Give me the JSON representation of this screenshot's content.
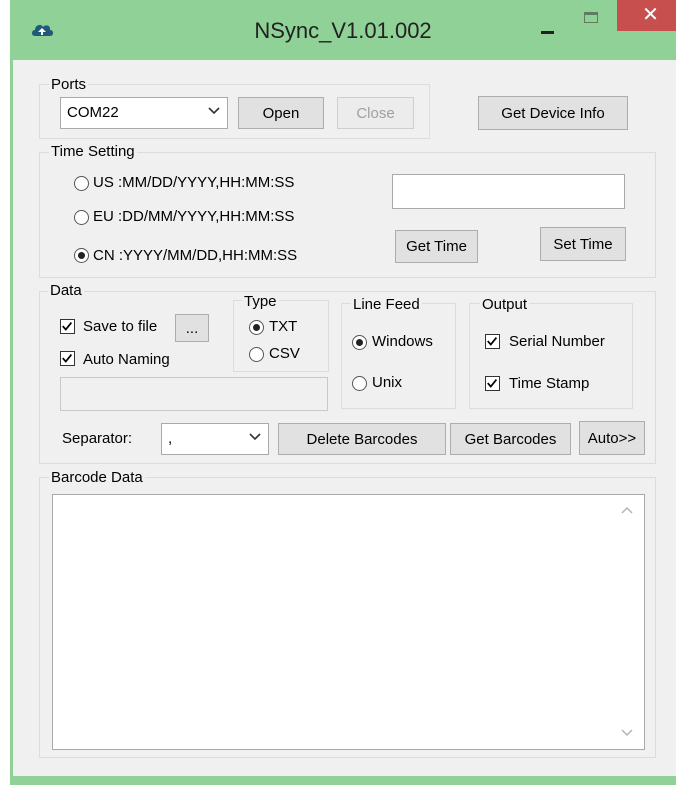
{
  "window": {
    "title": "NSync_V1.01.002",
    "close_glyph": "✕",
    "icon": "cloud-upload-icon",
    "accent": "#8fd197",
    "close_color": "#c7504e"
  },
  "ports": {
    "legend": "Ports",
    "com_value": "COM22",
    "open_label": "Open",
    "close_label": "Close",
    "device_info_label": "Get Device Info"
  },
  "time": {
    "legend": "Time Setting",
    "us_label": "US :MM/DD/YYYY,HH:MM:SS",
    "eu_label": "EU :DD/MM/YYYY,HH:MM:SS",
    "cn_label": "CN :YYYY/MM/DD,HH:MM:SS",
    "selected": "CN",
    "time_value": "",
    "get_label": "Get Time",
    "set_label": "Set Time"
  },
  "data": {
    "legend": "Data",
    "save_label": "Save to file",
    "save_checked": true,
    "browse_label": "...",
    "auto_naming_label": "Auto Naming",
    "auto_naming_checked": true,
    "path_value": "",
    "type_legend": "Type",
    "txt_label": "TXT",
    "csv_label": "CSV",
    "type_selected": "TXT",
    "linefeed_legend": "Line Feed",
    "windows_label": "Windows",
    "unix_label": "Unix",
    "linefeed_selected": "Windows",
    "output_legend": "Output",
    "serial_label": "Serial Number",
    "serial_checked": true,
    "timestamp_label": "Time Stamp",
    "timestamp_checked": true,
    "separator_label": "Separator:",
    "separator_value": ",",
    "delete_label": "Delete Barcodes",
    "get_label": "Get Barcodes",
    "auto_label": "Auto>>"
  },
  "barcode": {
    "legend": "Barcode Data",
    "content": ""
  }
}
